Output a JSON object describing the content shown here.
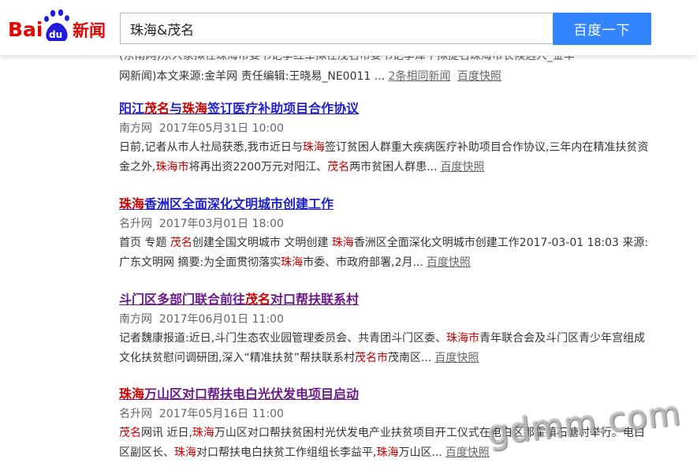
{
  "header": {
    "logo_text_bai": "Bai",
    "logo_text_du": "du",
    "logo_text_news": "新闻",
    "search_value": "珠海&茂名",
    "search_button": "百度一下"
  },
  "partial_result": {
    "cut_line": "(东南网)东人家拟任珠海市委书记李红军拟任茂名市委书记李泽平拟提名珠海市长候选人_金羊",
    "line_prefix": "网新闻)本文来源:金羊网 责任编辑:王晓易_NE0011 ...",
    "related_link": "2条相同新闻",
    "cache_link": "百度快照"
  },
  "results": [
    {
      "title_parts": [
        "阳江",
        "茂名",
        "与",
        "珠海",
        "签订医疗补助项目合作协议"
      ],
      "source": "南方网",
      "date": "2017年05月31日 10:00",
      "abstract_parts": [
        "日前,记者从市人社局获悉,我市近日与",
        "珠海",
        "签订贫困人群重大疾病医疗补助项目合作协议,三年内在精准扶贫资金之外,",
        "珠海市",
        "将再出资2200万元对阳江、",
        "茂名",
        "两市贫困人群患..."
      ],
      "cache_link": "百度快照"
    },
    {
      "title_parts": [
        "珠海",
        "香洲区全面深化文明城市创建工作"
      ],
      "source": "名升网",
      "date": "2017年03月01日 18:00",
      "abstract_parts": [
        "首页 专题 ",
        "茂名",
        "创建全国文明城市 文明创建 ",
        "珠海",
        "香洲区全面深化文明城市创建工作2017-03-01 18:03 来源: 广东文明网 摘要:为全面贯彻落实",
        "珠海",
        "市委、市政府部署,2月..."
      ],
      "cache_link": "百度快照"
    },
    {
      "title_parts": [
        "斗门区多部门联合前往",
        "茂名",
        "对口帮扶联系村"
      ],
      "source": "南方网",
      "date": "2017年06月01日 11:00",
      "abstract_parts": [
        "记者魏康报道:近日,斗门生态农业园管理委员会、共青团斗门区委、",
        "珠海市",
        "青年联合会及斗门区青少年宫组成文化扶贫慰问调研团,深入“精准扶贫”帮扶联系村",
        "茂名市",
        "茂南区..."
      ],
      "cache_link": "百度快照"
    },
    {
      "title_parts": [
        "珠海",
        "万山区对口帮扶电白光伏发电项目启动"
      ],
      "source": "名升网",
      "date": "2017年05月16日 11:00",
      "abstract_parts": [
        "茂名",
        "网讯 近日,",
        "珠海",
        "万山区对口帮扶贫困村光伏发电产业扶贫项目开工仪式在电白区那霍镇石塘村举行。电白区副区长、",
        "珠海",
        "对口帮扶电白扶贫工作组组长李益平,",
        "珠海",
        "万山区..."
      ],
      "cache_link": "百度快照"
    }
  ],
  "watermark": "gdmm.com"
}
